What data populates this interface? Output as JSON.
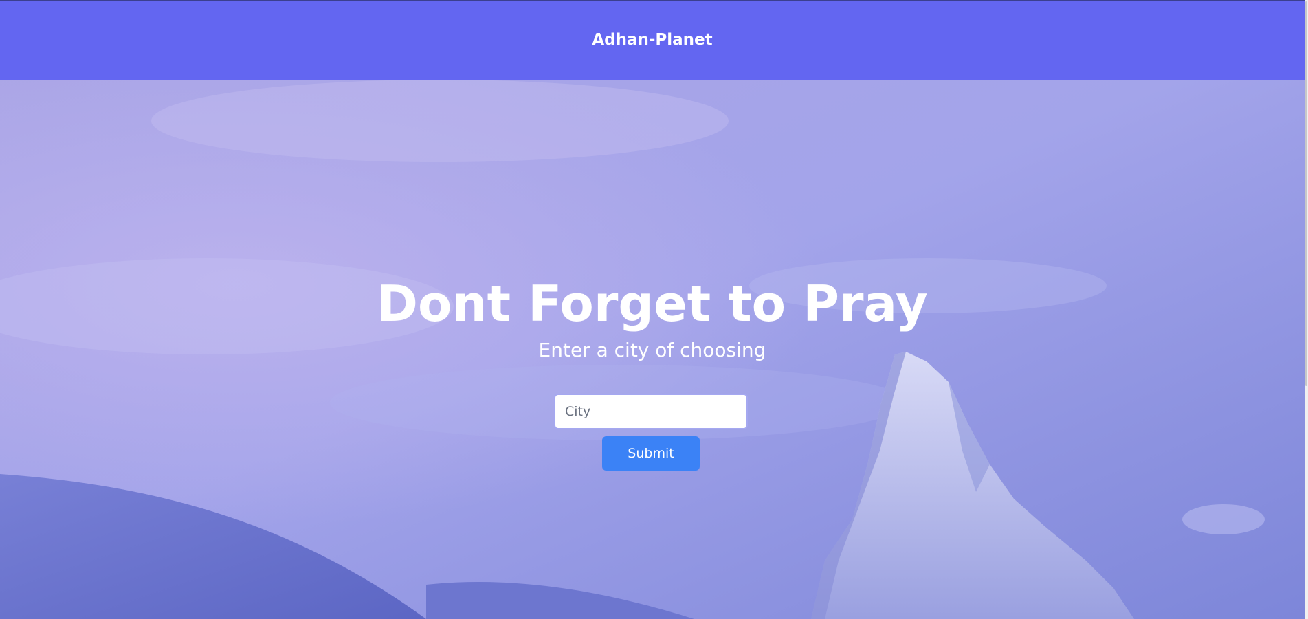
{
  "header": {
    "brand": "Adhan-Planet",
    "background_color": "#6366f1"
  },
  "hero": {
    "title": "Dont Forget to Pray",
    "subtitle": "Enter a city of choosing",
    "background_image": "snowy-mountain-peak-sky",
    "overlay_color": "#8b8cf0"
  },
  "form": {
    "city_placeholder": "City",
    "city_value": "",
    "submit_label": "Submit",
    "submit_color": "#3b82f6"
  }
}
